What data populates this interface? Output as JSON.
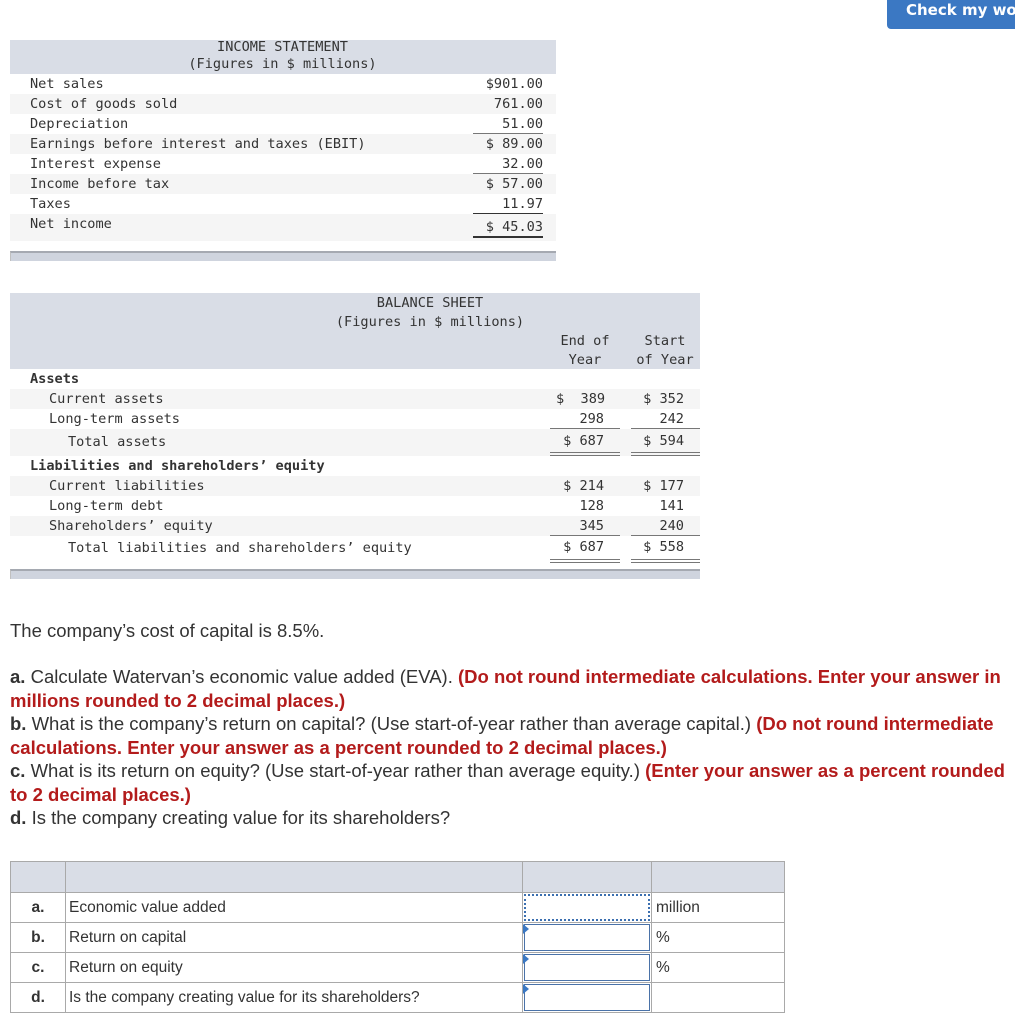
{
  "header": {
    "check_button": "Check my work"
  },
  "income_statement": {
    "title": "INCOME STATEMENT",
    "subtitle": "(Figures in $ millions)",
    "rows": [
      {
        "label": "Net sales",
        "value": "$901.00"
      },
      {
        "label": "Cost of goods sold",
        "value": "761.00"
      },
      {
        "label": "Depreciation",
        "value": "51.00"
      },
      {
        "label": "Earnings before interest and taxes (EBIT)",
        "value": "$ 89.00"
      },
      {
        "label": "Interest expense",
        "value": "32.00"
      },
      {
        "label": "Income before tax",
        "value": "$ 57.00"
      },
      {
        "label": "Taxes",
        "value": "11.97"
      },
      {
        "label": "Net income",
        "value": "$ 45.03"
      }
    ]
  },
  "balance_sheet": {
    "title": "BALANCE SHEET",
    "subtitle": "(Figures in $ millions)",
    "col_end": "End of\nYear",
    "col_start": "Start\nof Year",
    "col_end_l1": "End of",
    "col_end_l2": "Year",
    "col_start_l1": "Start",
    "col_start_l2": "of Year",
    "rows": [
      {
        "label": "Assets",
        "end": "",
        "start": ""
      },
      {
        "label": "Current assets",
        "end": "$  389",
        "start": "$ 352"
      },
      {
        "label": "Long-term assets",
        "end": "298",
        "start": "242"
      },
      {
        "label": "Total assets",
        "end": "$ 687",
        "start": "$ 594"
      },
      {
        "label": "Liabilities and shareholders’ equity",
        "end": "",
        "start": ""
      },
      {
        "label": "Current liabilities",
        "end": "$ 214",
        "start": "$ 177"
      },
      {
        "label": "Long-term debt",
        "end": "128",
        "start": "141"
      },
      {
        "label": "Shareholders’ equity",
        "end": "345",
        "start": "240"
      },
      {
        "label": "Total liabilities and shareholders’ equity",
        "end": "$ 687",
        "start": "$ 558"
      }
    ]
  },
  "question": {
    "intro": "The company’s cost of capital is 8.5%.",
    "a_lead": "a.",
    "a_text": " Calculate Watervan’s economic value added (EVA). ",
    "a_note": "(Do not round intermediate calculations. Enter your answer in millions rounded to 2 decimal places.)",
    "b_lead": "b.",
    "b_text": " What is the company’s return on capital? (Use start-of-year rather than average capital.) ",
    "b_note": "(Do not round intermediate calculations. Enter your answer as a percent rounded to 2 decimal places.)",
    "c_lead": "c.",
    "c_text": " What is its return on equity? (Use start-of-year rather than average equity.) ",
    "c_note": "(Enter your answer as a percent rounded to 2 decimal places.)",
    "d_lead": "d.",
    "d_text": " Is the company creating value for its shareholders?"
  },
  "answer_table": {
    "rows": [
      {
        "letter": "a.",
        "label": "Economic value added",
        "value": "",
        "unit": "million"
      },
      {
        "letter": "b.",
        "label": "Return on capital",
        "value": "",
        "unit": "%"
      },
      {
        "letter": "c.",
        "label": "Return on equity",
        "value": "",
        "unit": "%"
      },
      {
        "letter": "d.",
        "label": "Is the company creating value for its shareholders?",
        "value": "",
        "unit": ""
      }
    ]
  }
}
